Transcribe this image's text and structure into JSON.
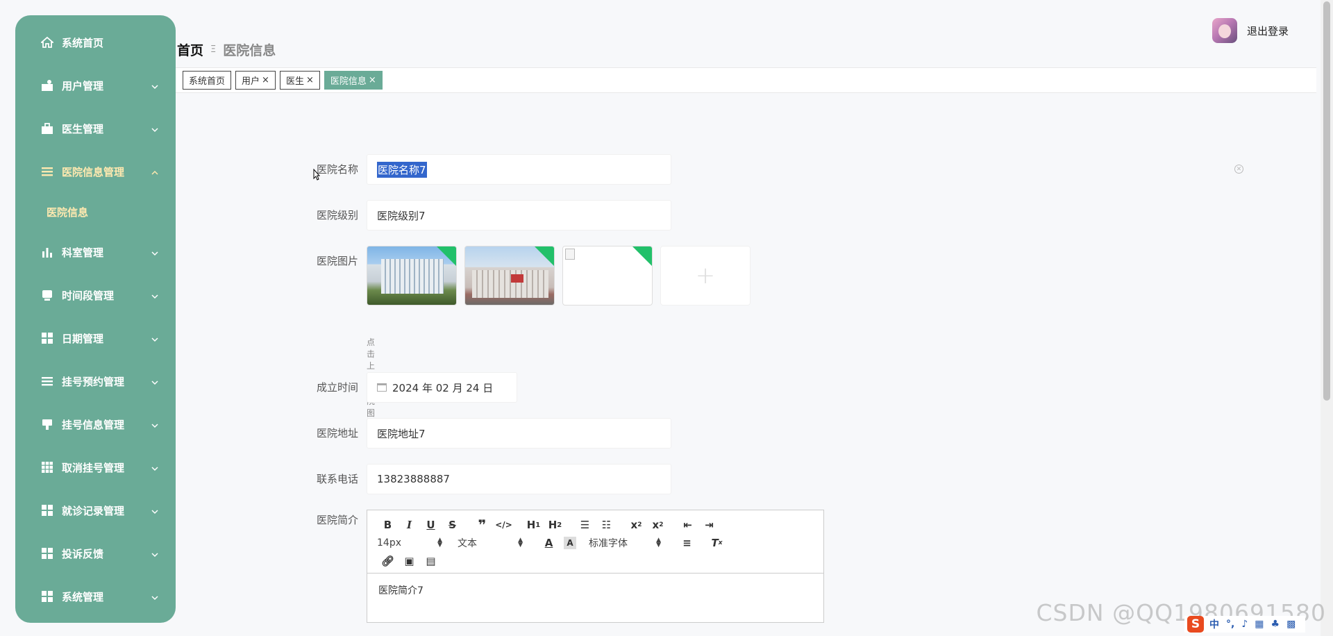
{
  "sidebar": {
    "items": [
      {
        "label": "系统首页",
        "icon": "home-icon",
        "chevron": false
      },
      {
        "label": "用户管理",
        "icon": "user-icon",
        "chevron": true
      },
      {
        "label": "医生管理",
        "icon": "briefcase-icon",
        "chevron": true
      },
      {
        "label": "医院信息管理",
        "icon": "list-icon",
        "chevron": true,
        "open": true,
        "sub": [
          "医院信息"
        ]
      },
      {
        "label": "科室管理",
        "icon": "bar-chart-icon",
        "chevron": true
      },
      {
        "label": "时间段管理",
        "icon": "clock-icon",
        "chevron": true
      },
      {
        "label": "日期管理",
        "icon": "grid-icon",
        "chevron": true
      },
      {
        "label": "挂号预约管理",
        "icon": "list-icon",
        "chevron": true
      },
      {
        "label": "挂号信息管理",
        "icon": "pin-icon",
        "chevron": true
      },
      {
        "label": "取消挂号管理",
        "icon": "table-icon",
        "chevron": true
      },
      {
        "label": "就诊记录管理",
        "icon": "grid-icon",
        "chevron": true
      },
      {
        "label": "投诉反馈",
        "icon": "grid-icon",
        "chevron": true
      },
      {
        "label": "系统管理",
        "icon": "grid-icon",
        "chevron": true
      }
    ]
  },
  "header": {
    "crumb_home": "首页",
    "crumb_sep": "Ξ",
    "crumb_current": "医院信息",
    "logout": "退出登录"
  },
  "tabs": [
    {
      "label": "系统首页",
      "closable": false,
      "active": false
    },
    {
      "label": "用户",
      "closable": true,
      "active": false
    },
    {
      "label": "医生",
      "closable": true,
      "active": false
    },
    {
      "label": "医院信息",
      "closable": true,
      "active": true
    }
  ],
  "form": {
    "name_label": "医院名称",
    "name_value": "医院名称7",
    "level_label": "医院级别",
    "level_value": "医院级别7",
    "image_label": "医院图片",
    "image_hint": "点击上传医院图片",
    "date_label": "成立时间",
    "date_value": "2024 年 02 月 24 日",
    "address_label": "医院地址",
    "address_value": "医院地址7",
    "phone_label": "联系电话",
    "phone_value": "13823888887",
    "intro_label": "医院简介",
    "intro_value": "医院简介7"
  },
  "editor": {
    "size_select": "14px",
    "header_select": "文本",
    "font_select": "标准字体"
  },
  "watermark": "CSDN @QQ1980691580",
  "ime_text": "中"
}
